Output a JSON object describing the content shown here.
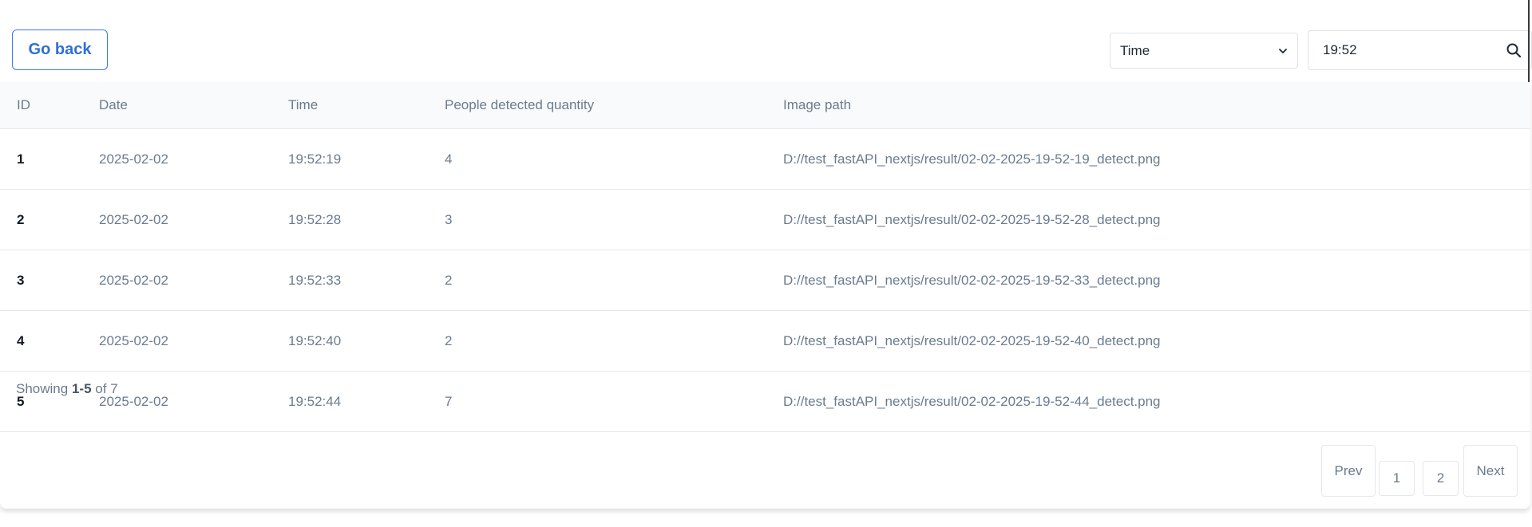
{
  "toolbar": {
    "go_back_label": "Go back",
    "filter_field": "Time",
    "search_value": "19:52"
  },
  "table": {
    "headers": [
      "ID",
      "Date",
      "Time",
      "People detected quantity",
      "Image path"
    ],
    "rows": [
      {
        "id": "1",
        "date": "2025-02-02",
        "time": "19:52:19",
        "qty": "4",
        "path": "D://test_fastAPI_nextjs/result/02-02-2025-19-52-19_detect.png"
      },
      {
        "id": "2",
        "date": "2025-02-02",
        "time": "19:52:28",
        "qty": "3",
        "path": "D://test_fastAPI_nextjs/result/02-02-2025-19-52-28_detect.png"
      },
      {
        "id": "3",
        "date": "2025-02-02",
        "time": "19:52:33",
        "qty": "2",
        "path": "D://test_fastAPI_nextjs/result/02-02-2025-19-52-33_detect.png"
      },
      {
        "id": "4",
        "date": "2025-02-02",
        "time": "19:52:40",
        "qty": "2",
        "path": "D://test_fastAPI_nextjs/result/02-02-2025-19-52-40_detect.png"
      },
      {
        "id": "5",
        "date": "2025-02-02",
        "time": "19:52:44",
        "qty": "7",
        "path": "D://test_fastAPI_nextjs/result/02-02-2025-19-52-44_detect.png"
      }
    ]
  },
  "pagination": {
    "showing_prefix": "Showing",
    "showing_range": "1-5",
    "showing_of": "of",
    "total": "7",
    "prev_label": "Prev",
    "pages": [
      "1",
      "2"
    ],
    "next_label": "Next"
  },
  "colors": {
    "accent": "#2f6fd8",
    "text_muted": "#6b7b8f",
    "text_strong": "#111827",
    "header_bg": "#f9fafb",
    "border": "#e5e7eb"
  },
  "icons": {
    "select_caret": "chevron-down-icon",
    "search": "search-icon"
  }
}
